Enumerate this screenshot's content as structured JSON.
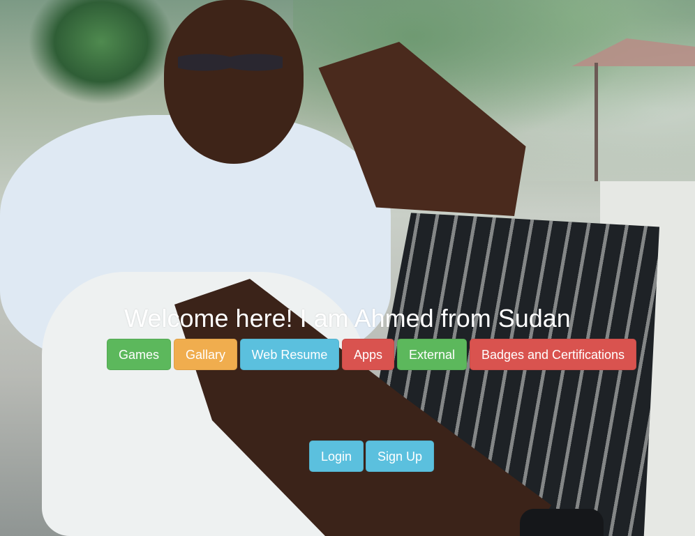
{
  "hero": {
    "title": "Welcome here! I am Ahmed from Sudan"
  },
  "nav": {
    "items": [
      {
        "label": "Games",
        "color": "#5cb85c"
      },
      {
        "label": "Gallary",
        "color": "#f0ad4e"
      },
      {
        "label": "Web Resume",
        "color": "#5bc0de"
      },
      {
        "label": "Apps",
        "color": "#d9534f"
      },
      {
        "label": "External",
        "color": "#5cb85c"
      },
      {
        "label": "Badges and Certifications",
        "color": "#d9534f"
      }
    ]
  },
  "auth": {
    "login_label": "Login",
    "signup_label": "Sign Up"
  }
}
